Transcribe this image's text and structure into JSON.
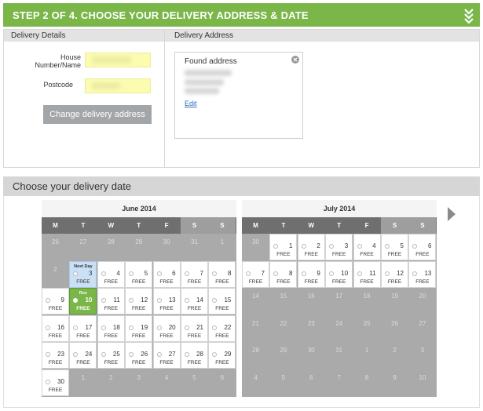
{
  "header": {
    "title": "STEP 2 OF 4. CHOOSE YOUR DELIVERY ADDRESS & DATE"
  },
  "details": {
    "left_heading": "Delivery Details",
    "right_heading": "Delivery Address",
    "house_label_line1": "House",
    "house_label_line2": "Number/Name",
    "postcode_label": "Postcode",
    "change_button": "Change delivery address",
    "found_address": "Found address",
    "edit_link": "Edit"
  },
  "date": {
    "title": "Choose your delivery date"
  },
  "calendar": {
    "weekdays": [
      "M",
      "T",
      "W",
      "T",
      "F",
      "S",
      "S"
    ],
    "months": [
      {
        "name": "June 2014",
        "rows": [
          [
            {
              "d": "26",
              "s": "off"
            },
            {
              "d": "27",
              "s": "off"
            },
            {
              "d": "28",
              "s": "off"
            },
            {
              "d": "29",
              "s": "off"
            },
            {
              "d": "30",
              "s": "off"
            },
            {
              "d": "31",
              "s": "off"
            },
            {
              "d": "1",
              "s": "off"
            }
          ],
          [
            {
              "d": "2",
              "s": "off"
            },
            {
              "d": "3",
              "s": "nextday",
              "tag": "Next Day"
            },
            {
              "d": "4",
              "s": "free"
            },
            {
              "d": "5",
              "s": "free"
            },
            {
              "d": "6",
              "s": "free"
            },
            {
              "d": "7",
              "s": "free"
            },
            {
              "d": "8",
              "s": "free"
            }
          ],
          [
            {
              "d": "9",
              "s": "free"
            },
            {
              "d": "10",
              "s": "selected",
              "tag": "Rsv"
            },
            {
              "d": "11",
              "s": "free"
            },
            {
              "d": "12",
              "s": "free"
            },
            {
              "d": "13",
              "s": "free"
            },
            {
              "d": "14",
              "s": "free"
            },
            {
              "d": "15",
              "s": "free"
            }
          ],
          [
            {
              "d": "16",
              "s": "free"
            },
            {
              "d": "17",
              "s": "free"
            },
            {
              "d": "18",
              "s": "free"
            },
            {
              "d": "19",
              "s": "free"
            },
            {
              "d": "20",
              "s": "free"
            },
            {
              "d": "21",
              "s": "free"
            },
            {
              "d": "22",
              "s": "free"
            }
          ],
          [
            {
              "d": "23",
              "s": "free"
            },
            {
              "d": "24",
              "s": "free"
            },
            {
              "d": "25",
              "s": "free"
            },
            {
              "d": "26",
              "s": "free"
            },
            {
              "d": "27",
              "s": "free"
            },
            {
              "d": "28",
              "s": "free"
            },
            {
              "d": "29",
              "s": "free"
            }
          ],
          [
            {
              "d": "30",
              "s": "free"
            },
            {
              "d": "1",
              "s": "off"
            },
            {
              "d": "2",
              "s": "off"
            },
            {
              "d": "3",
              "s": "off"
            },
            {
              "d": "4",
              "s": "off"
            },
            {
              "d": "5",
              "s": "off"
            },
            {
              "d": "6",
              "s": "off"
            }
          ]
        ]
      },
      {
        "name": "July 2014",
        "rows": [
          [
            {
              "d": "30",
              "s": "off"
            },
            {
              "d": "1",
              "s": "free"
            },
            {
              "d": "2",
              "s": "free"
            },
            {
              "d": "3",
              "s": "free"
            },
            {
              "d": "4",
              "s": "free"
            },
            {
              "d": "5",
              "s": "free"
            },
            {
              "d": "6",
              "s": "free"
            }
          ],
          [
            {
              "d": "7",
              "s": "free"
            },
            {
              "d": "8",
              "s": "free"
            },
            {
              "d": "9",
              "s": "free"
            },
            {
              "d": "10",
              "s": "free"
            },
            {
              "d": "11",
              "s": "free"
            },
            {
              "d": "12",
              "s": "free"
            },
            {
              "d": "13",
              "s": "free"
            }
          ],
          [
            {
              "d": "14",
              "s": "off"
            },
            {
              "d": "15",
              "s": "off"
            },
            {
              "d": "16",
              "s": "off"
            },
            {
              "d": "17",
              "s": "off"
            },
            {
              "d": "18",
              "s": "off"
            },
            {
              "d": "19",
              "s": "off"
            },
            {
              "d": "20",
              "s": "off"
            }
          ],
          [
            {
              "d": "21",
              "s": "off"
            },
            {
              "d": "22",
              "s": "off"
            },
            {
              "d": "23",
              "s": "off"
            },
            {
              "d": "24",
              "s": "off"
            },
            {
              "d": "25",
              "s": "off"
            },
            {
              "d": "26",
              "s": "off"
            },
            {
              "d": "27",
              "s": "off"
            }
          ],
          [
            {
              "d": "28",
              "s": "off"
            },
            {
              "d": "29",
              "s": "off"
            },
            {
              "d": "30",
              "s": "off"
            },
            {
              "d": "31",
              "s": "off"
            },
            {
              "d": "1",
              "s": "off"
            },
            {
              "d": "2",
              "s": "off"
            },
            {
              "d": "3",
              "s": "off"
            }
          ],
          [
            {
              "d": "4",
              "s": "off"
            },
            {
              "d": "5",
              "s": "off"
            },
            {
              "d": "6",
              "s": "off"
            },
            {
              "d": "7",
              "s": "off"
            },
            {
              "d": "8",
              "s": "off"
            },
            {
              "d": "9",
              "s": "off"
            },
            {
              "d": "10",
              "s": "off"
            }
          ]
        ]
      }
    ],
    "free_label": "FREE"
  },
  "colors": {
    "accent": "#7ab648",
    "next_day": "#c9e0f5",
    "inactive": "#aaaaaa"
  },
  "icons": {
    "collapse": "double-chevron-down-icon",
    "close": "close-icon",
    "next": "next-arrow-icon"
  }
}
